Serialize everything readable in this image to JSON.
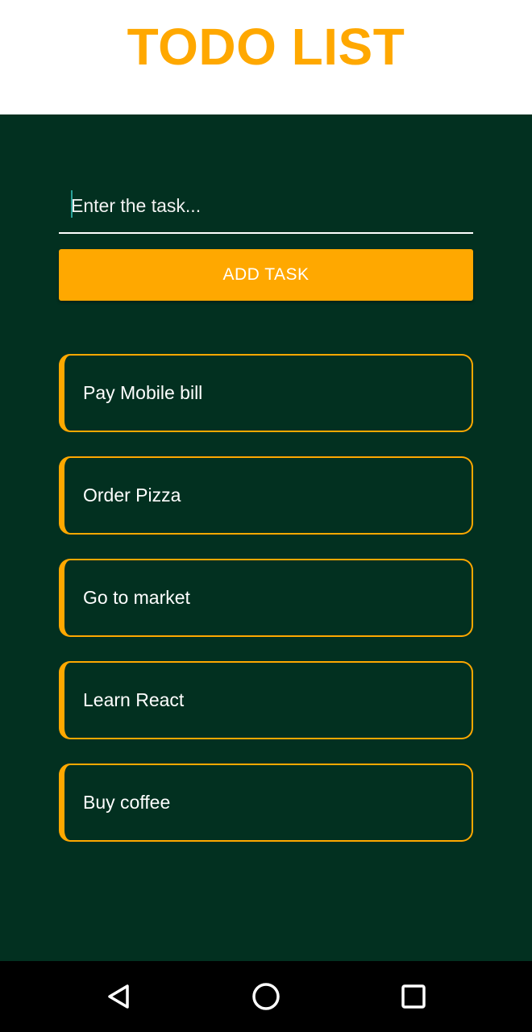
{
  "header": {
    "title": "TODO LIST"
  },
  "input": {
    "placeholder": "Enter the task...",
    "value": ""
  },
  "add_button": {
    "label": "ADD TASK"
  },
  "tasks": [
    {
      "label": "Pay Mobile bill"
    },
    {
      "label": "Order Pizza"
    },
    {
      "label": "Go to market"
    },
    {
      "label": "Learn React"
    },
    {
      "label": "Buy coffee"
    }
  ],
  "navbar": {
    "icons": [
      "back-icon",
      "home-icon",
      "recents-icon"
    ]
  },
  "colors": {
    "accent": "#ffa800",
    "background": "#023020",
    "header_background": "#ffffff",
    "text": "#ffffff",
    "navbar": "#000000"
  }
}
